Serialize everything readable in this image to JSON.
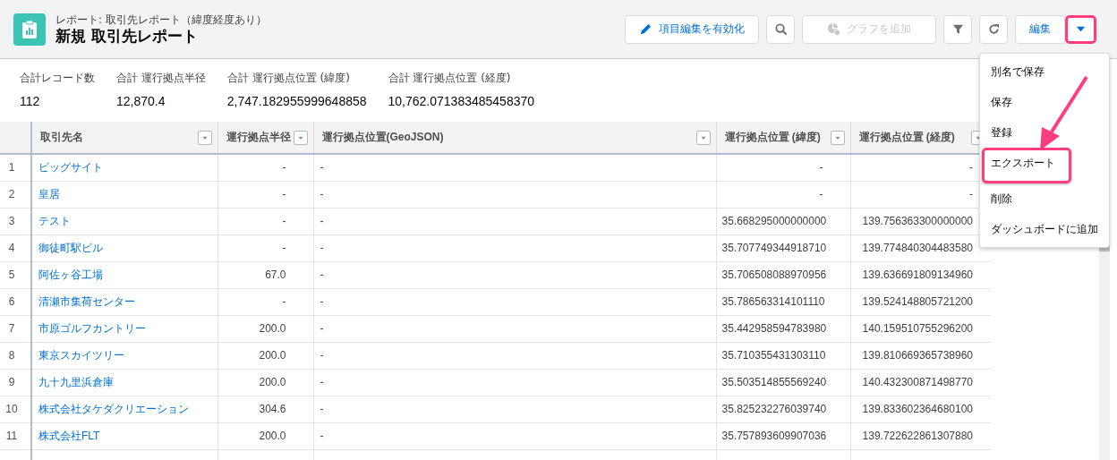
{
  "header": {
    "subtitle": "レポート: 取引先レポート（緯度経度あり）",
    "title": "新規 取引先レポート"
  },
  "toolbar": [
    {
      "kind": "text-icon",
      "label": "項目編集を有効化",
      "disabled": false
    },
    {
      "kind": "icon",
      "disabled": false
    },
    {
      "kind": "text-icon",
      "label": "グラフを追加",
      "disabled": true
    },
    {
      "kind": "icon",
      "disabled": false
    },
    {
      "kind": "icon",
      "disabled": false
    },
    {
      "kind": "text",
      "label": "編集",
      "disabled": false
    },
    {
      "kind": "dropdown",
      "disabled": false,
      "highlighted": true
    }
  ],
  "summary": [
    {
      "label": "合計レコード数",
      "value": "112"
    },
    {
      "label": "合計 運行拠点半径",
      "value": "12,870.4"
    },
    {
      "label": "合計 運行拠点位置 (緯度)",
      "value": "2,747.182955999648858"
    },
    {
      "label": "合計 運行拠点位置 (経度)",
      "value": "10,762.071383485458370"
    }
  ],
  "table": {
    "columns": [
      {
        "label": "取引先名"
      },
      {
        "label": "運行拠点半径"
      },
      {
        "label": "運行拠点位置(GeoJSON)"
      },
      {
        "label": "運行拠点位置 (緯度)"
      },
      {
        "label": "運行拠点位置 (経度)"
      }
    ],
    "rows": [
      {
        "number": "1",
        "cells": [
          "ビッグサイト",
          "-",
          "-",
          "-",
          "-"
        ]
      },
      {
        "number": "2",
        "cells": [
          "皇居",
          "-",
          "-",
          "-",
          "-"
        ]
      },
      {
        "number": "3",
        "cells": [
          "テスト",
          "-",
          "-",
          "35.668295000000000",
          "139.756363300000000"
        ]
      },
      {
        "number": "4",
        "cells": [
          "御徒町駅ビル",
          "-",
          "-",
          "35.707749344918710",
          "139.774840304483580"
        ]
      },
      {
        "number": "5",
        "cells": [
          "阿佐ヶ谷工場",
          "67.0",
          "-",
          "35.706508088970956",
          "139.636691809134960"
        ]
      },
      {
        "number": "6",
        "cells": [
          "清瀬市集荷センター",
          "-",
          "-",
          "35.786563314101110",
          "139.524148805721200"
        ]
      },
      {
        "number": "7",
        "cells": [
          "市原ゴルフカントリー",
          "200.0",
          "-",
          "35.442958594783980",
          "140.159510755296200"
        ]
      },
      {
        "number": "8",
        "cells": [
          "東京スカイツリー",
          "200.0",
          "-",
          "35.710355431303110",
          "139.810669365738960"
        ]
      },
      {
        "number": "9",
        "cells": [
          "九十九里浜倉庫",
          "200.0",
          "-",
          "35.503514855569240",
          "140.432300871498770"
        ]
      },
      {
        "number": "10",
        "cells": [
          "株式会社タケダクリエーション",
          "304.6",
          "-",
          "35.825232276039740",
          "139.833602364680100"
        ]
      },
      {
        "number": "11",
        "cells": [
          "株式会社FLT",
          "200.0",
          "-",
          "35.757893609907036",
          "139.722622861307880"
        ]
      }
    ]
  },
  "menu": {
    "items": [
      {
        "label": "別名で保存",
        "highlighted": false
      },
      {
        "label": "保存",
        "highlighted": false
      },
      {
        "label": "登録",
        "highlighted": false
      },
      {
        "label": "エクスポート",
        "highlighted": true
      },
      {
        "label": "削除",
        "highlighted": false
      },
      {
        "label": "ダッシュボードに追加",
        "highlighted": false
      }
    ]
  }
}
